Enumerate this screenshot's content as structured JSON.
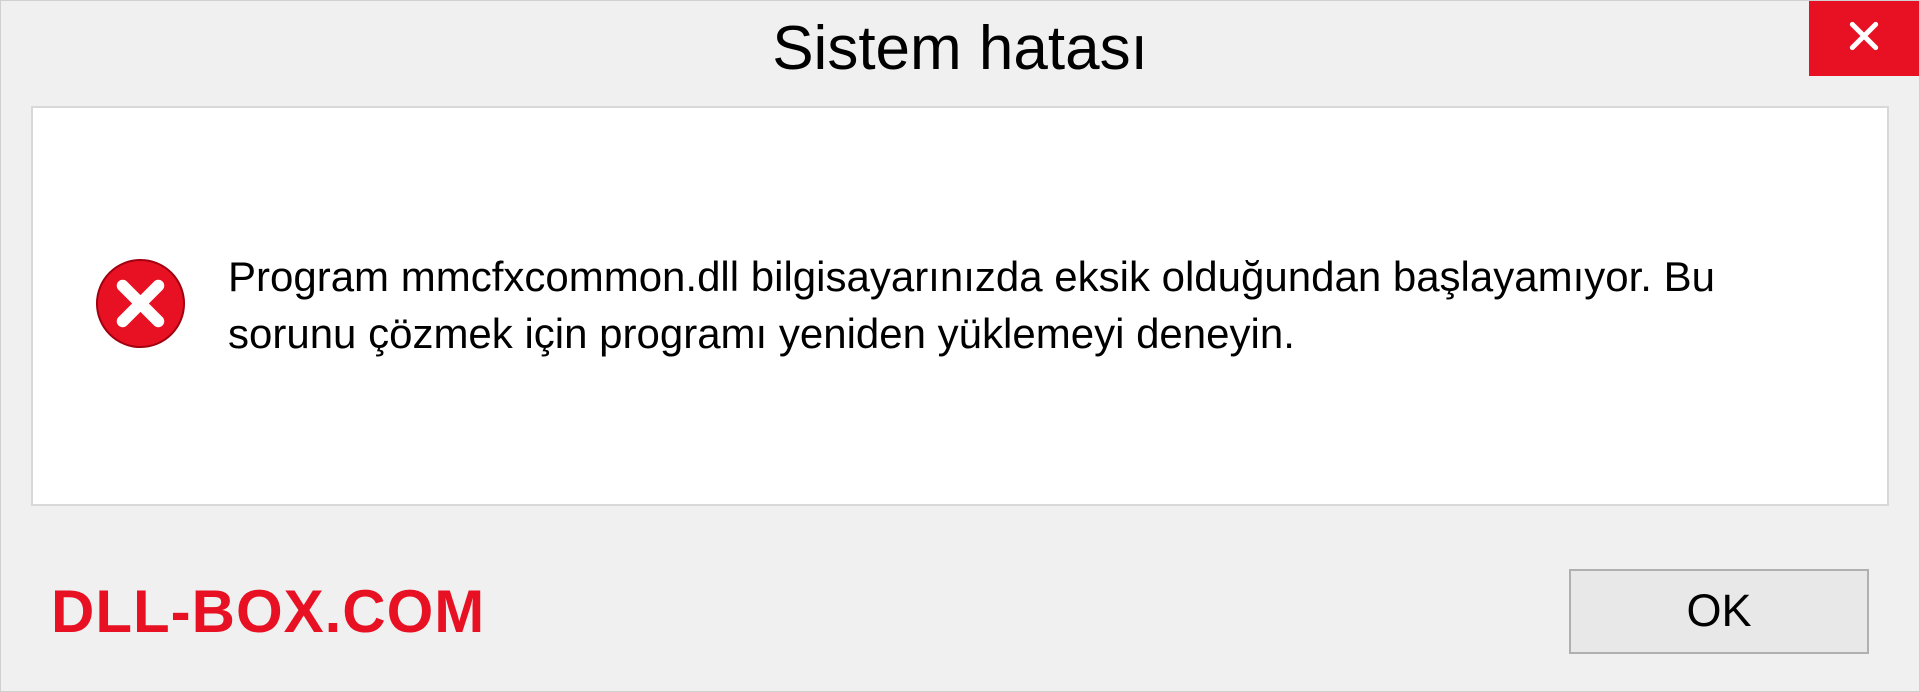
{
  "dialog": {
    "title": "Sistem hatası",
    "message": "Program mmcfxcommon.dll bilgisayarınızda eksik olduğundan başlayamıyor. Bu sorunu çözmek için programı yeniden yüklemeyi deneyin.",
    "ok_label": "OK"
  },
  "watermark": "DLL-BOX.COM",
  "colors": {
    "close_bg": "#e81123",
    "watermark": "#e81123"
  }
}
